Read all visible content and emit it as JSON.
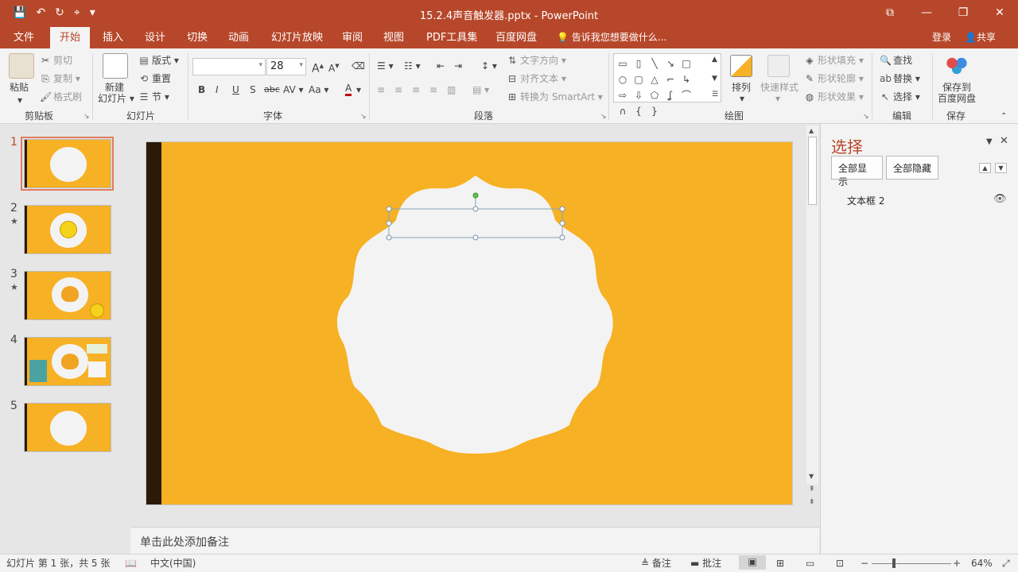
{
  "window": {
    "title": "15.2.4声音触发器.pptx - PowerPoint",
    "restore_glyph": "⧉",
    "minimize_glyph": "—",
    "maximize_glyph": "❐",
    "close_glyph": "✕"
  },
  "qat": {
    "save": "💾",
    "undo": "↶",
    "redo": "↻",
    "customize": "▾",
    "touch": "⌖"
  },
  "menu": {
    "tabs": [
      "文件",
      "开始",
      "插入",
      "设计",
      "切换",
      "动画",
      "幻灯片放映",
      "审阅",
      "视图",
      "PDF工具集",
      "百度网盘"
    ],
    "active_tab": "开始",
    "tell_me": "告诉我您想要做什么...",
    "login": "登录",
    "share": "共享"
  },
  "ribbon": {
    "clipboard": {
      "paste": "粘贴",
      "cut": "剪切",
      "copy": "复制",
      "format_painter": "格式刷",
      "group": "剪贴板"
    },
    "slides": {
      "new_slide_1": "新建",
      "new_slide_2": "幻灯片",
      "layout": "版式",
      "reset": "重置",
      "section": "节",
      "group": "幻灯片"
    },
    "font": {
      "font_name": "",
      "font_size": "28",
      "grow": "A",
      "shrink": "A",
      "bold": "B",
      "italic": "I",
      "underline": "U",
      "shadow": "S",
      "strike": "abc",
      "spacing": "AV",
      "case": "Aa",
      "color": "A",
      "group": "字体"
    },
    "paragraph": {
      "text_direction": "文字方向",
      "align_text": "对齐文本",
      "smartart": "转换为 SmartArt",
      "group": "段落"
    },
    "drawing": {
      "arrange": "排列",
      "quick_styles": "快速样式",
      "shape_fill": "形状填充",
      "shape_outline": "形状轮廓",
      "shape_effects": "形状效果",
      "group": "绘图"
    },
    "editing": {
      "find": "查找",
      "replace": "替换",
      "select": "选择",
      "group": "编辑"
    },
    "save": {
      "line1": "保存到",
      "line2": "百度网盘",
      "group": "保存"
    }
  },
  "thumbnails": [
    {
      "num": "1",
      "star": ""
    },
    {
      "num": "2",
      "star": "★"
    },
    {
      "num": "3",
      "star": "★"
    },
    {
      "num": "4",
      "star": ""
    },
    {
      "num": "5",
      "star": ""
    }
  ],
  "notes": {
    "placeholder": "单击此处添加备注"
  },
  "selection_pane": {
    "title": "选择",
    "show_all": "全部显示",
    "hide_all": "全部隐藏",
    "items": [
      {
        "label": "文本框 2"
      }
    ]
  },
  "status": {
    "slide_info": "幻灯片 第 1 张，共 5 张",
    "language": "中文(中国)",
    "notes": "备注",
    "comments": "批注",
    "zoom": "64%"
  },
  "colors": {
    "accent": "#b7472a",
    "slide_bg": "#f7b124",
    "slide_bar": "#2a1a07",
    "shape_fill": "#f3f3f3",
    "selected_frame": "#e27c5b"
  }
}
